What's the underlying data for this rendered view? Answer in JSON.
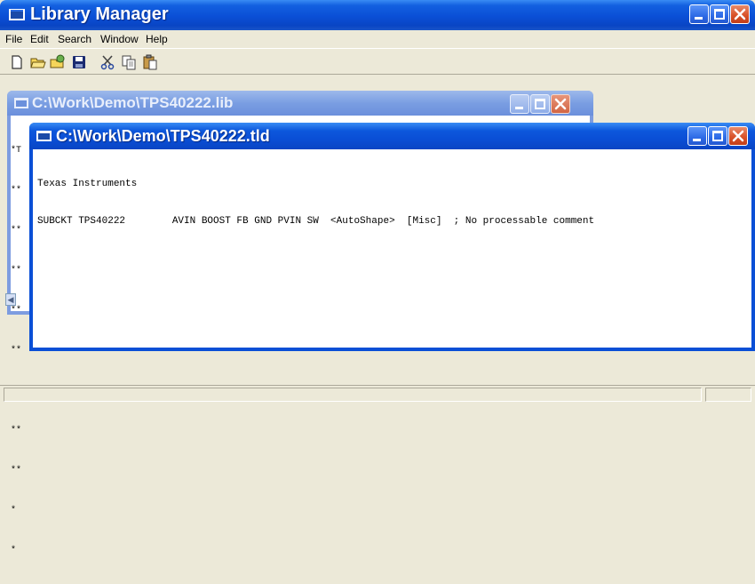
{
  "app": {
    "title": "Library Manager",
    "accent": "#0a4fd6",
    "menu": [
      "File",
      "Edit",
      "Search",
      "Window",
      "Help"
    ],
    "toolbar_icons": [
      "new-file-icon",
      "open-folder-icon",
      "open-recent-icon",
      "save-icon",
      "cut-icon",
      "copy-icon",
      "paste-icon"
    ]
  },
  "lib_window": {
    "title": "C:\\Work\\Demo\\TPS40222.lib",
    "lines": [
      "*T",
      "**",
      "**",
      "**",
      "**",
      "**",
      "**",
      "**",
      "**",
      "*",
      "*"
    ]
  },
  "tld_window": {
    "title": "C:\\Work\\Demo\\TPS40222.tld",
    "lines": [
      "Texas Instruments",
      "SUBCKT TPS40222        AVIN BOOST FB GND PVIN SW  <AutoShape>  [Misc]  ; No processable comment"
    ]
  }
}
